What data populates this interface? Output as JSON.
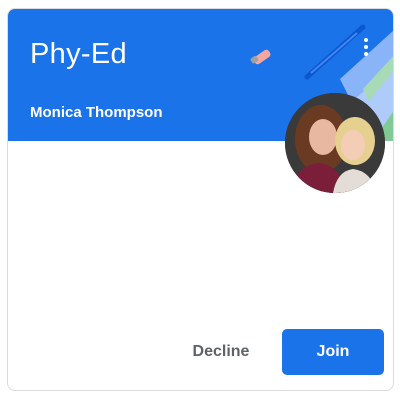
{
  "card": {
    "title": "Phy-Ed",
    "owner": "Monica Thompson",
    "menu_icon": "more-vert-icon",
    "avatar_icon": "teacher-avatar-photo"
  },
  "actions": {
    "decline_label": "Decline",
    "join_label": "Join"
  },
  "colors": {
    "banner": "#1a73e8",
    "join_button": "#1a73e8",
    "decline_text": "#5f6368"
  }
}
